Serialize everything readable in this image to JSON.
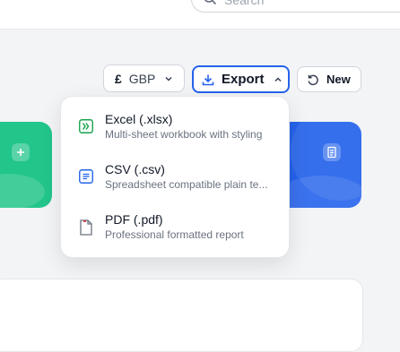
{
  "search": {
    "placeholder": "Search"
  },
  "toolbar": {
    "currency_symbol": "£",
    "currency_code": "GBP",
    "export_label": "Export",
    "new_label": "New"
  },
  "export_menu": {
    "items": [
      {
        "title": "Excel (.xlsx)",
        "description": "Multi-sheet workbook with styling",
        "icon": "excel-file-icon",
        "color": "#16a34a"
      },
      {
        "title": "CSV (.csv)",
        "description": "Spreadsheet compatible plain te...",
        "icon": "csv-file-icon",
        "color": "#2563eb"
      },
      {
        "title": "PDF (.pdf)",
        "description": "Professional formatted report",
        "icon": "pdf-file-icon",
        "color": "#dc2626"
      }
    ]
  },
  "colors": {
    "accent": "#2563eb",
    "green_card": "#22c58a",
    "blue_card": "#2563eb"
  }
}
